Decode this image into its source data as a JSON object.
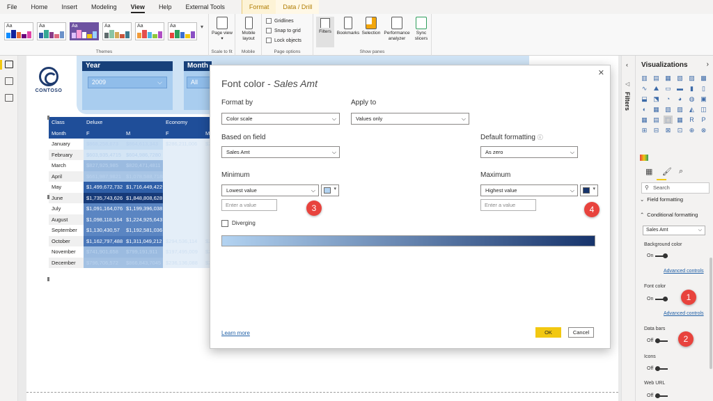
{
  "menu": {
    "items": [
      "File",
      "Home",
      "Insert",
      "Modeling",
      "View",
      "Help",
      "External Tools"
    ],
    "active": "View",
    "context_tabs": [
      "Format",
      "Data / Drill"
    ]
  },
  "ribbon": {
    "themes_label": "Themes",
    "theme_thumb_text": "Aa",
    "scale_label": "Scale to fit",
    "page_view_label": "Page view",
    "mobile_group_label": "Mobile",
    "mobile_layout_label": "Mobile layout",
    "page_options_label": "Page options",
    "gridlines_label": "Gridlines",
    "snap_label": "Snap to grid",
    "lock_label": "Lock objects",
    "show_panes_label": "Show panes",
    "filters_label": "Filters",
    "bookmarks_label": "Bookmarks",
    "selection_label": "Selection",
    "performance_label": "Performance analyzer",
    "sync_label": "Sync slicers"
  },
  "report": {
    "logo_text": "CONTOSO",
    "year_slicer": {
      "title": "Year",
      "value": "2009"
    },
    "month_slicer": {
      "title": "Month",
      "value": "All"
    },
    "matrix": {
      "header_row1": [
        "Class",
        "Deluxe",
        "",
        "Economy",
        ""
      ],
      "header_row2": [
        "Month",
        "F",
        "M",
        "F",
        "M"
      ],
      "rows": [
        {
          "month": "January",
          "deluxe_f": "$868,258,673",
          "deluxe_m": "$864,613,343",
          "econ_f": "$286,211,006",
          "econ_m": "$28"
        },
        {
          "month": "February",
          "deluxe_f": "$603,935,4715",
          "deluxe_m": "$604,986,7280",
          "econ_f": "",
          "econ_m": ""
        },
        {
          "month": "March",
          "deluxe_f": "$827,925,985",
          "deluxe_m": "$820,471,4811",
          "econ_f": "",
          "econ_m": ""
        },
        {
          "month": "April",
          "deluxe_f": "$661,987,9821",
          "deluxe_m": "$1,078,588,7188",
          "econ_f": "",
          "econ_m": ""
        },
        {
          "month": "May",
          "deluxe_f": "$1,499,672,732",
          "deluxe_m": "$1,716,449,422",
          "econ_f": "",
          "econ_m": ""
        },
        {
          "month": "June",
          "deluxe_f": "$1,735,743,626",
          "deluxe_m": "$1,848,808,628",
          "econ_f": "",
          "econ_m": ""
        },
        {
          "month": "July",
          "deluxe_f": "$1,091,164,076",
          "deluxe_m": "$1,199,396,038",
          "econ_f": "",
          "econ_m": ""
        },
        {
          "month": "August",
          "deluxe_f": "$1,098,118,164",
          "deluxe_m": "$1,224,925,643",
          "econ_f": "",
          "econ_m": ""
        },
        {
          "month": "September",
          "deluxe_f": "$1,130,430,57",
          "deluxe_m": "$1,192,581,036",
          "econ_f": "",
          "econ_m": ""
        },
        {
          "month": "October",
          "deluxe_f": "$1,162,797,488",
          "deluxe_m": "$1,311,049,212",
          "econ_f": "$294,536,114",
          "econ_m": "$29"
        },
        {
          "month": "November",
          "deluxe_f": "$741,901,658",
          "deluxe_m": "$799,191,911",
          "econ_f": "$197,495,009",
          "econ_m": "$21"
        },
        {
          "month": "December",
          "deluxe_f": "$796,706,572",
          "deluxe_m": "$866,843,7045",
          "econ_f": "$236,136,088",
          "econ_m": "$20"
        }
      ],
      "deluxe_colors": [
        "#c5dcf2",
        "#d4e5f5",
        "#9bbbe0",
        "#a8c5e5",
        "#2f5fa8",
        "#173a78",
        "#5a85c2",
        "#5a85c2",
        "#5a85c2",
        "#4a77b9",
        "#9bbbe0",
        "#a3c1e3"
      ],
      "econ_color": "#e4eef8"
    }
  },
  "dialog": {
    "title_prefix": "Font color - ",
    "title_field": "Sales Amt",
    "format_by_label": "Format by",
    "format_by_value": "Color scale",
    "apply_to_label": "Apply to",
    "apply_to_value": "Values only",
    "based_on_label": "Based on field",
    "based_on_value": "Sales Amt",
    "default_fmt_label": "Default formatting",
    "default_fmt_value": "As zero",
    "minimum_label": "Minimum",
    "minimum_value": "Lowest value",
    "minimum_input_placeholder": "Enter a value",
    "min_color": "#b3d3f1",
    "maximum_label": "Maximum",
    "maximum_value": "Highest value",
    "maximum_input_placeholder": "Enter a value",
    "max_color": "#17346c",
    "diverging_label": "Diverging",
    "learn_more": "Learn more",
    "ok": "OK",
    "cancel": "Cancel"
  },
  "callouts": [
    "1",
    "2",
    "3",
    "4"
  ],
  "filters_pane": {
    "label": "Filters"
  },
  "viz_pane": {
    "title": "Visualizations",
    "search_placeholder": "Search",
    "field_formatting": "Field formatting",
    "conditional_formatting": "Conditional formatting",
    "field_value": "Sales Amt",
    "background_color": "Background color",
    "background_state": "On",
    "advanced_controls_1": "Advanced controls",
    "font_color": "Font color",
    "font_state": "On",
    "advanced_controls_2": "Advanced controls",
    "data_bars": "Data bars",
    "data_bars_state": "Off",
    "icons": "Icons",
    "icons_state": "Off",
    "web_url": "Web URL",
    "web_url_state": "Off"
  }
}
